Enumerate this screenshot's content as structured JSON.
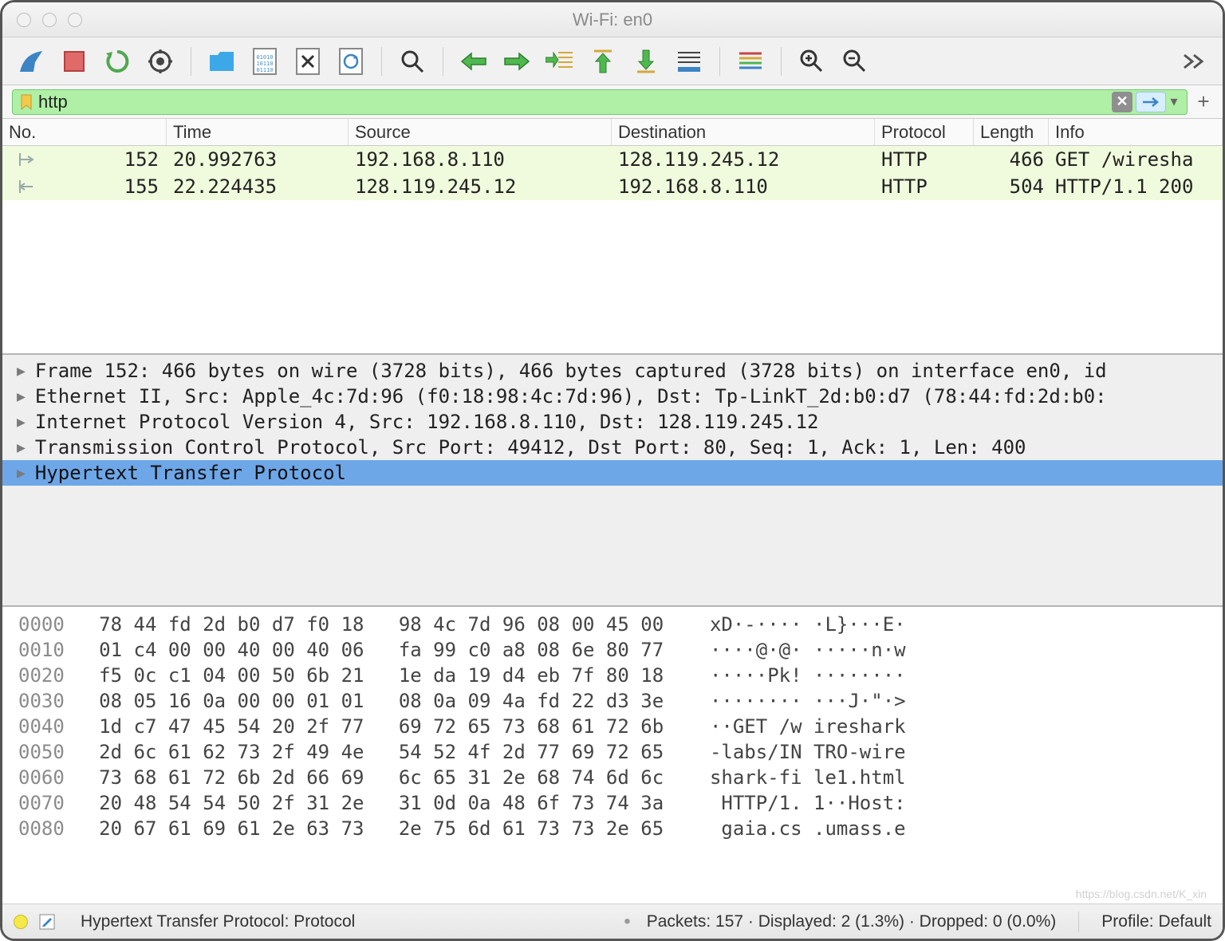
{
  "window": {
    "title": "Wi-Fi: en0"
  },
  "filter": {
    "value": "http"
  },
  "columns": {
    "no": "No.",
    "time": "Time",
    "src": "Source",
    "dst": "Destination",
    "proto": "Protocol",
    "len": "Length",
    "info": "Info"
  },
  "packets": [
    {
      "dir": "out",
      "no": "152",
      "time": "20.992763",
      "src": "192.168.8.110",
      "dst": "128.119.245.12",
      "proto": "HTTP",
      "len": "466",
      "info": "GET /wiresha"
    },
    {
      "dir": "in",
      "no": "155",
      "time": "22.224435",
      "src": "128.119.245.12",
      "dst": "192.168.8.110",
      "proto": "HTTP",
      "len": "504",
      "info": "HTTP/1.1 200"
    }
  ],
  "details": [
    "Frame 152: 466 bytes on wire (3728 bits), 466 bytes captured (3728 bits) on interface en0, id",
    "Ethernet II, Src: Apple_4c:7d:96 (f0:18:98:4c:7d:96), Dst: Tp-LinkT_2d:b0:d7 (78:44:fd:2d:b0:",
    "Internet Protocol Version 4, Src: 192.168.8.110, Dst: 128.119.245.12",
    "Transmission Control Protocol, Src Port: 49412, Dst Port: 80, Seq: 1, Ack: 1, Len: 400",
    "Hypertext Transfer Protocol"
  ],
  "details_selected": 4,
  "hex": [
    {
      "off": "0000",
      "b1": "78 44 fd 2d b0 d7 f0 18",
      "b2": "98 4c 7d 96 08 00 45 00",
      "asc": "xD·-···· ·L}···E·"
    },
    {
      "off": "0010",
      "b1": "01 c4 00 00 40 00 40 06",
      "b2": "fa 99 c0 a8 08 6e 80 77",
      "asc": "····@·@· ·····n·w"
    },
    {
      "off": "0020",
      "b1": "f5 0c c1 04 00 50 6b 21",
      "b2": "1e da 19 d4 eb 7f 80 18",
      "asc": "·····Pk! ········"
    },
    {
      "off": "0030",
      "b1": "08 05 16 0a 00 00 01 01",
      "b2": "08 0a 09 4a fd 22 d3 3e",
      "asc": "········ ···J·\"·>"
    },
    {
      "off": "0040",
      "b1": "1d c7 47 45 54 20 2f 77",
      "b2": "69 72 65 73 68 61 72 6b",
      "asc": "··GET /w ireshark"
    },
    {
      "off": "0050",
      "b1": "2d 6c 61 62 73 2f 49 4e",
      "b2": "54 52 4f 2d 77 69 72 65",
      "asc": "-labs/IN TRO-wire"
    },
    {
      "off": "0060",
      "b1": "73 68 61 72 6b 2d 66 69",
      "b2": "6c 65 31 2e 68 74 6d 6c",
      "asc": "shark-fi le1.html"
    },
    {
      "off": "0070",
      "b1": "20 48 54 54 50 2f 31 2e",
      "b2": "31 0d 0a 48 6f 73 74 3a",
      "asc": " HTTP/1. 1··Host:"
    },
    {
      "off": "0080",
      "b1": "20 67 61 69 61 2e 63 73",
      "b2": "2e 75 6d 61 73 73 2e 65",
      "asc": " gaia.cs .umass.e"
    }
  ],
  "status": {
    "left": "Hypertext Transfer Protocol: Protocol",
    "mid": "Packets: 157 · Displayed: 2 (1.3%) · Dropped: 0 (0.0%)",
    "profile": "Profile: Default"
  },
  "watermark": "https://blog.csdn.net/K_xin"
}
